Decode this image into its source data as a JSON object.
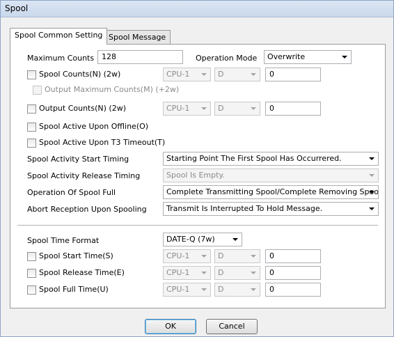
{
  "window": {
    "title": "Spool"
  },
  "tabs": [
    {
      "label": "Spool Common Setting"
    },
    {
      "label": "Spool Message"
    }
  ],
  "max_counts": {
    "label": "Maximum Counts",
    "value": "128"
  },
  "operation_mode": {
    "label": "Operation Mode",
    "value": "Overwrite"
  },
  "spool_counts": {
    "label": "Spool Counts(N) (2w)",
    "cpu": "CPU-1",
    "device": "D",
    "number": "0"
  },
  "output_max_counts": {
    "label": "Output Maximum Counts(M) (+2w)"
  },
  "output_counts": {
    "label": "Output Counts(N) (2w)",
    "cpu": "CPU-1",
    "device": "D",
    "number": "0"
  },
  "active_offline": {
    "label": "Spool Active Upon Offline(O)"
  },
  "active_t3": {
    "label": "Spool Active Upon T3 Timeout(T)"
  },
  "start_timing": {
    "label": "Spool Activity Start Timing",
    "value": "Starting Point The First Spool Has Occurrered."
  },
  "release_timing": {
    "label": "Spool Activity Release Timing",
    "value": "Spool Is Empty."
  },
  "spool_full": {
    "label": "Operation Of Spool Full",
    "value": "Complete Transmitting Spool/Complete Removing Spool."
  },
  "abort_reception": {
    "label": "Abort Reception Upon Spooling",
    "value": "Transmit Is Interrupted To Hold Message."
  },
  "time_format": {
    "label": "Spool Time Format",
    "value": "DATE-Q (7w)"
  },
  "start_time": {
    "label": "Spool Start Time(S)",
    "cpu": "CPU-1",
    "device": "D",
    "number": "0"
  },
  "release_time": {
    "label": "Spool Release Time(E)",
    "cpu": "CPU-1",
    "device": "D",
    "number": "0"
  },
  "full_time": {
    "label": "Spool Full Time(U)",
    "cpu": "CPU-1",
    "device": "D",
    "number": "0"
  },
  "buttons": {
    "ok": "OK",
    "cancel": "Cancel"
  }
}
